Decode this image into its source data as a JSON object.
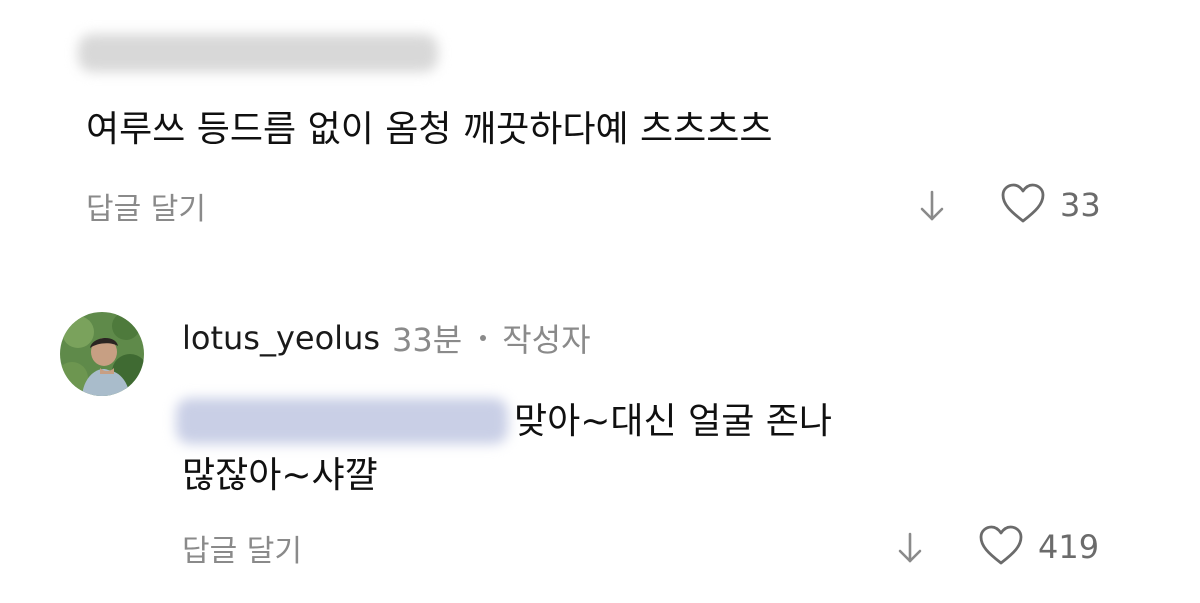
{
  "comments": [
    {
      "text": "여루쓰 등드름 없이 옴청 깨끗하다예 츠츠츠츠",
      "reply_label": "답글 달기",
      "like_count": "33"
    },
    {
      "username": "lotus_yeolus",
      "timestamp": "33분",
      "author_badge": "작성자",
      "text_line1": "맞아~대신 얼굴 존나",
      "text_line2": "많잖아~샤꺌",
      "reply_label": "답글 달기",
      "like_count": "419"
    }
  ],
  "icons": {
    "down_arrow": "down-arrow-icon",
    "heart": "heart-icon"
  },
  "colors": {
    "text": "#101010",
    "muted": "#8a8a8a",
    "like_count": "#6b6b6b",
    "blur_mention": "#c9cfe6"
  }
}
